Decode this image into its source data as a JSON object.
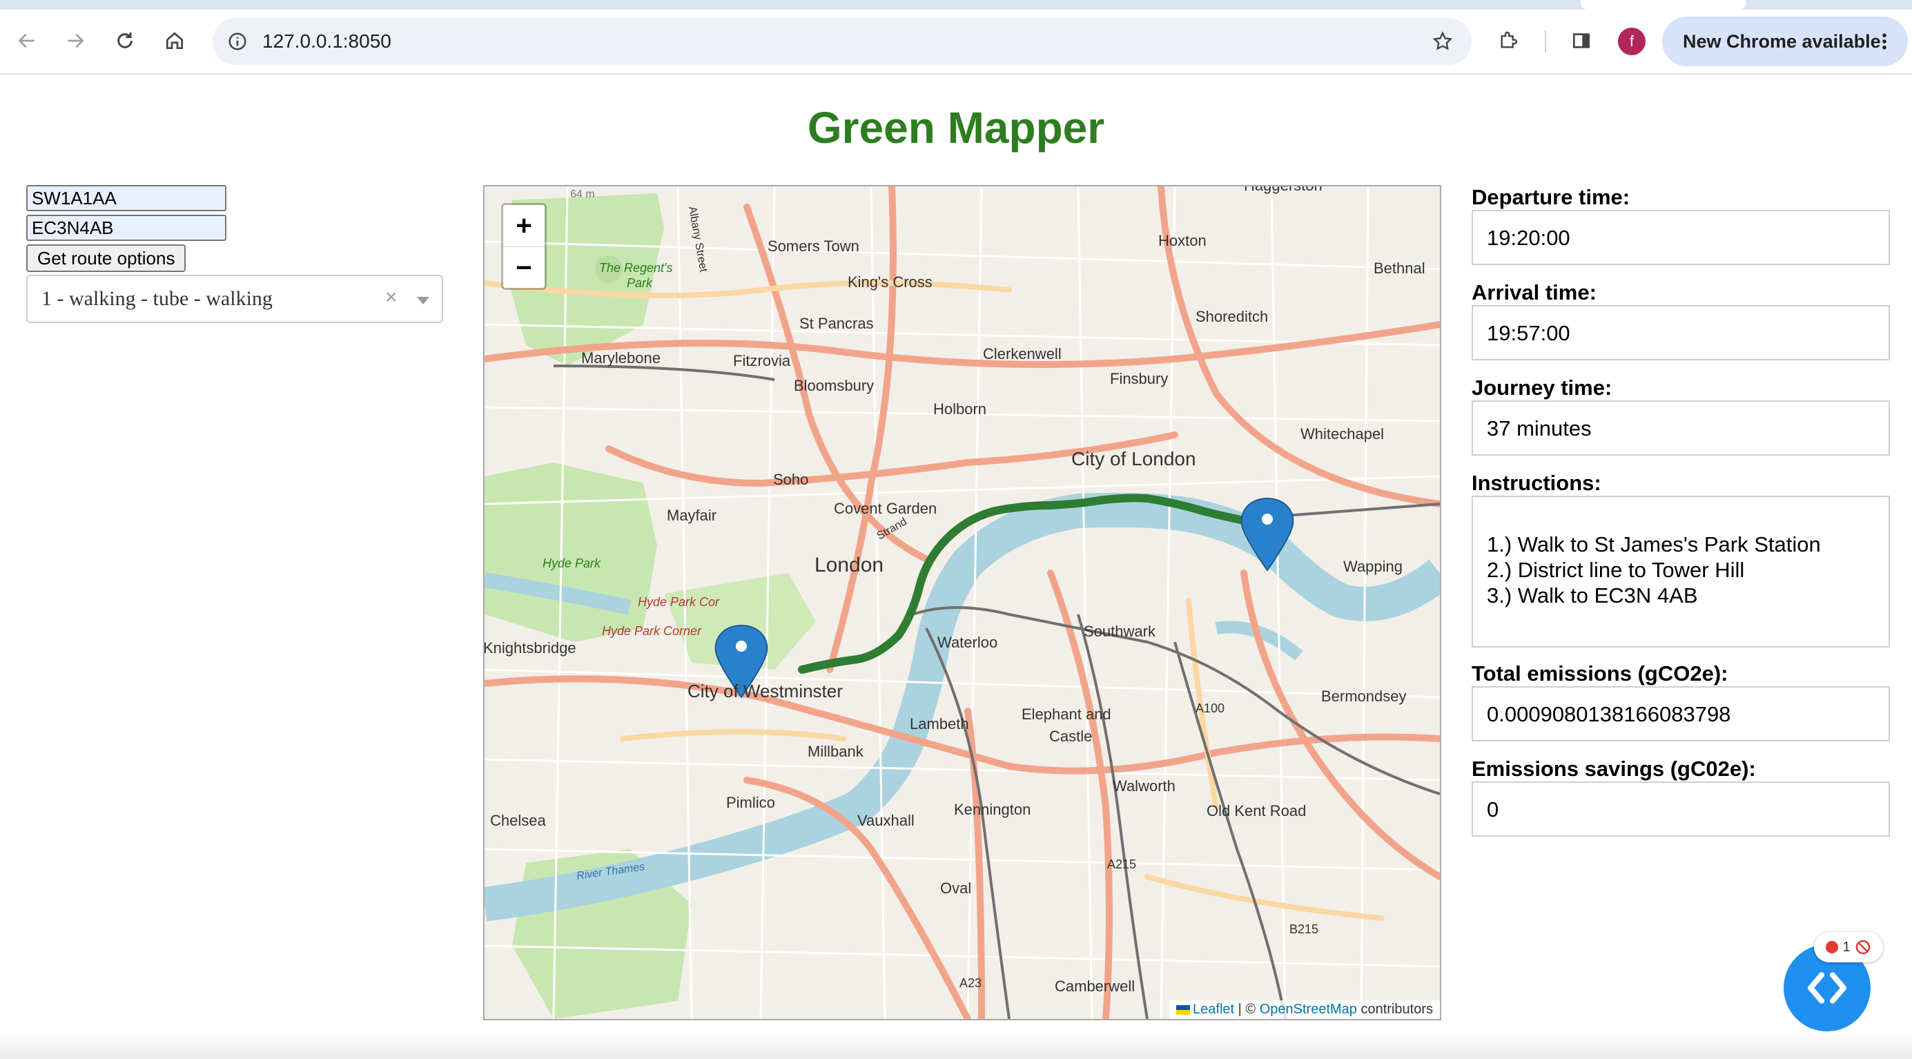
{
  "browser": {
    "url": "127.0.0.1:8050",
    "update_button_label": "New Chrome available",
    "profile_initial": "f"
  },
  "page": {
    "title": "Green Mapper",
    "title_color": "#2e7d20"
  },
  "form": {
    "origin_value": "SW1A1AA",
    "destination_value": "EC3N4AB",
    "route_button_label": "Get route options",
    "route_option_selected": "1 - walking - tube - walking"
  },
  "map": {
    "zoom_in_label": "+",
    "zoom_out_label": "−",
    "route_color": "#2e7d32",
    "place_labels": [
      "Haggerston",
      "Hoxton",
      "Bethnal",
      "Somers Town",
      "King's Cross",
      "St Pancras",
      "Shoreditch",
      "Marylebone",
      "Fitzrovia",
      "Clerkenwell",
      "Bloomsbury",
      "Finsbury",
      "Holborn",
      "Whitechapel",
      "City of London",
      "Soho",
      "Mayfair",
      "Covent Garden",
      "Strand",
      "London",
      "Wapping",
      "Hyde Park",
      "Hyde Park Cor",
      "Hyde Park Corner",
      "Knightsbridge",
      "Waterloo",
      "Southwark",
      "City of Westminster",
      "Elephant and",
      "Castle",
      "A100",
      "Bermondsey",
      "Lambeth",
      "Millbank",
      "Pimlico",
      "Walworth",
      "Kennington",
      "Old Kent Road",
      "Chelsea",
      "Vauxhall",
      "A215",
      "River Thames",
      "Oval",
      "B215",
      "A23",
      "Camberwell",
      "The Regent's",
      "Park",
      "Albany Street",
      "64 m"
    ],
    "attribution": {
      "leaflet": "Leaflet",
      "separator": "| ©",
      "osm": "OpenStreetMap",
      "contributors": "contributors"
    }
  },
  "results": {
    "departure_label": "Departure time:",
    "departure_value": "19:20:00",
    "arrival_label": "Arrival time:",
    "arrival_value": "19:57:00",
    "journey_label": "Journey time:",
    "journey_value": "37 minutes",
    "instructions_label": "Instructions:",
    "instructions": [
      "1.) Walk to St James's Park Station",
      "2.) District line to Tower Hill",
      "3.) Walk to EC3N 4AB"
    ],
    "emissions_label": "Total emissions (gCO2e):",
    "emissions_value": "0.0009080138166083798",
    "savings_label": "Emissions savings (gC02e):",
    "savings_value": "0"
  },
  "devtools": {
    "error_count": "1"
  }
}
